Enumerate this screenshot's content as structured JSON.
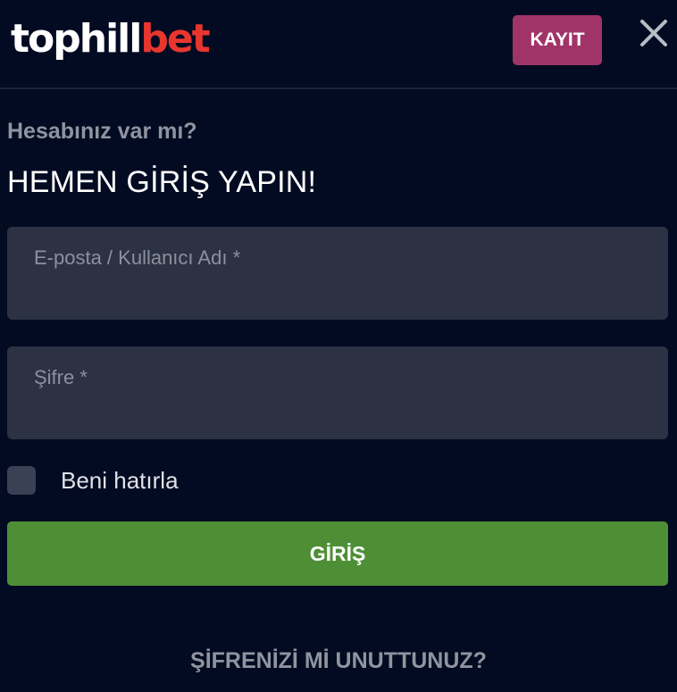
{
  "header": {
    "logo_part1": "tophill",
    "logo_part2": "bet",
    "register_label": "KAYIT",
    "close_icon": "close-icon"
  },
  "form": {
    "subtitle": "Hesabınız var mı?",
    "title": "HEMEN GİRİŞ YAPIN!",
    "email_placeholder": "E-posta / Kullanıcı Adı *",
    "email_value": "",
    "password_placeholder": "Şifre *",
    "password_value": "",
    "remember_label": "Beni hatırla",
    "remember_checked": false,
    "login_label": "GİRİŞ",
    "forgot_label": "ŞİFRENİZİ Mİ UNUTTUNUZ?"
  },
  "colors": {
    "background": "#020b22",
    "register_button": "#a03468",
    "login_button": "#4e8f36",
    "input_background": "#2c3244",
    "logo_accent": "#e8362f"
  }
}
